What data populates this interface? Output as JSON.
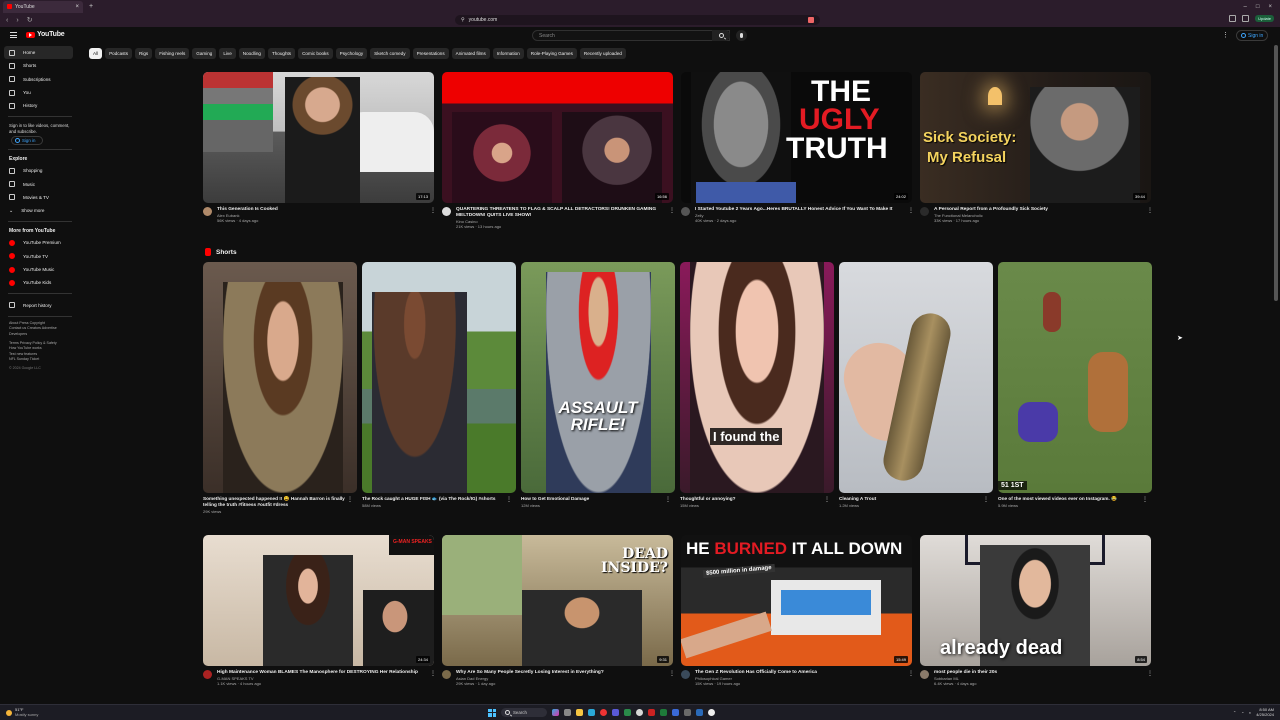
{
  "browser": {
    "tab_title": "YouTube",
    "url": "youtube.com",
    "update_label": "Update"
  },
  "header": {
    "logo": "YouTube",
    "search_placeholder": "Search",
    "sign_in": "Sign in"
  },
  "chips": [
    "All",
    "Podcasts",
    "Rigs",
    "Fishing reels",
    "Gaming",
    "Live",
    "Noodling",
    "Thoughts",
    "Comic books",
    "Psychology",
    "Sketch comedy",
    "Presentations",
    "Animated films",
    "Information",
    "Role-Playing Games",
    "Recently uploaded"
  ],
  "sidebar": {
    "main": [
      "Home",
      "Shorts",
      "Subscriptions",
      "You",
      "History"
    ],
    "signin_note": "Sign in to like videos, comment, and subscribe.",
    "signin_button": "Sign in",
    "explore_title": "Explore",
    "explore": [
      "Shopping",
      "Music",
      "Movies & TV",
      "Show more"
    ],
    "more_title": "More from YouTube",
    "more": [
      "YouTube Premium",
      "YouTube TV",
      "YouTube Music",
      "YouTube Kids"
    ],
    "report": "Report history",
    "footer1": "About  Press  Copyright",
    "footer2": "Contact us  Creators  Advertise",
    "footer3": "Developers",
    "footer4": "Terms  Privacy  Policy & Safety",
    "footer5": "How YouTube works",
    "footer6": "Test new features",
    "footer7": "NFL Sunday Ticket",
    "copyright": "© 2024 Google LLC"
  },
  "row1": [
    {
      "title": "This Generation Is Cooked",
      "channel": "Alex Eubank",
      "stats": "56K views · 4 days ago",
      "duration": "17:13"
    },
    {
      "title": "QUARTERING THREATENS TO FLAG & SCALP ALL DETRACTORS! DRUNKEN GAMING MELTDOWN! QUITS LIVE SHOW!",
      "channel": "Kino Casino",
      "stats": "21K views · 13 hours ago",
      "duration": "16:56"
    },
    {
      "title": "I Started Youtube 2 Years Ago...Heres BRUTALLY Honest Advice If You Want To Make It",
      "channel": "Zelly",
      "stats": "40K views · 2 days ago",
      "duration": "24:02"
    },
    {
      "title": "A Personal Report from a Profoundly Sick Society",
      "channel": "The Functional Melancholic",
      "stats": "33K views · 17 hours ago",
      "duration": "39:44"
    }
  ],
  "overlays": {
    "ugly1": "THE",
    "ugly2": "UGLY",
    "ugly3": "TRUTH",
    "sick1": "Sick Society:",
    "sick2": "My Refusal",
    "assault": "ASSAULT RIFLE!",
    "found": "I found the",
    "score": "51   1ST",
    "dead": "DEAD INSIDE?",
    "burned1": "HE ",
    "burned2": "BURNED",
    "burned3": " IT ALL DOWN",
    "million": "$500 million in damage",
    "already": "already dead",
    "gman": "G-MAN SPEAKS"
  },
  "shorts_title": "Shorts",
  "shorts": [
    {
      "title": "Something unexpected happened !! 😩 Hannah Barron is finally telling the truth #fitness #outfit #dress",
      "views": "29K views"
    },
    {
      "title": "The Rock caught a HUGE FISH 🐟 (via The Rock/IG) #shorts",
      "views": "58M views"
    },
    {
      "title": "How to Get Emotional Damage",
      "views": "12M views"
    },
    {
      "title": "Thoughtful or annoying?",
      "views": "15M views"
    },
    {
      "title": "Cleaning A Trout",
      "views": "1.2M views"
    },
    {
      "title": "One of the most viewed videos ever on Instagram. 😂",
      "views": "5.9M views"
    }
  ],
  "row2": [
    {
      "title": "High Maintenance Woman BLAMES The Manosphere for DESTROYING Her Relationship",
      "channel": "G-MAN SPEAKS TV",
      "stats": "1.1K views · 4 hours ago",
      "duration": "24:34"
    },
    {
      "title": "Why Are So Many People Secretly Losing Interest in Everything?",
      "channel": "Asian Dad Energy",
      "stats": "29K views · 1 day ago",
      "duration": "9:31"
    },
    {
      "title": "The Gen Z Revolution Has Officially Come to America",
      "channel": "Philosophical Gamer",
      "stats": "15K views · 19 hours ago",
      "duration": "15:49"
    },
    {
      "title": "most people die in their 20s",
      "channel": "Sobbarian ML",
      "stats": "6.4K views · 4 days ago",
      "duration": "8:54"
    }
  ],
  "taskbar": {
    "temp": "51°F",
    "weather": "Mostly sunny",
    "search": "Search",
    "time": "8:50 AM",
    "date": "4/25/2024"
  }
}
